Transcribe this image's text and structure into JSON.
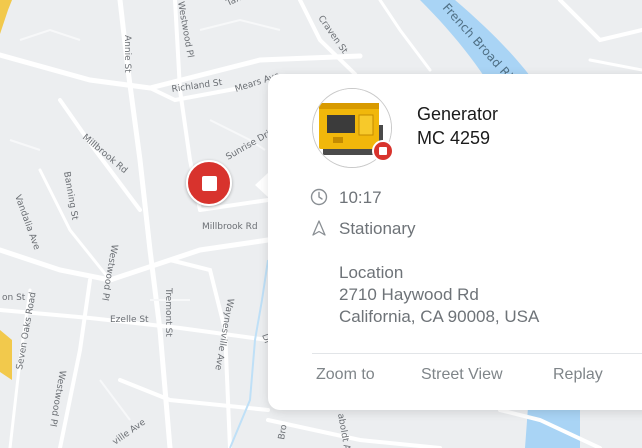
{
  "map": {
    "streets": [
      "Annie St",
      "Westwood Pl",
      "Taxahaw",
      "Craven St",
      "Richland St",
      "Mears Ave",
      "Millbrook Rd",
      "Sunrise Drive",
      "Millbrook Rd",
      "Banning St",
      "Vandalia Ave",
      "Westwood Pl",
      "Tremont St",
      "Waynesville Ave",
      "Ezelle St",
      "on St",
      "Seven Oaks Road",
      "Westwood Pl",
      "ville Ave",
      "Dr",
      "aboldt Ave",
      "Bro"
    ],
    "river_label": "French Broad River",
    "colors": {
      "land": "#eceef0",
      "road": "#ffffff",
      "water": "#a9d4f5",
      "highway": "#f2c94c"
    }
  },
  "marker": {
    "icon": "stop-icon",
    "status": "stopped",
    "color": "#d8332d"
  },
  "popup": {
    "asset_name_line1": "Generator",
    "asset_name_line2": "MC 4259",
    "time": "10:17",
    "state": "Stationary",
    "location_label": "Location",
    "address_line1": "2710 Haywood Rd",
    "address_line2": "California, CA 90008, USA",
    "actions": {
      "zoom": "Zoom to",
      "street_view": "Street View",
      "replay": "Replay"
    }
  }
}
